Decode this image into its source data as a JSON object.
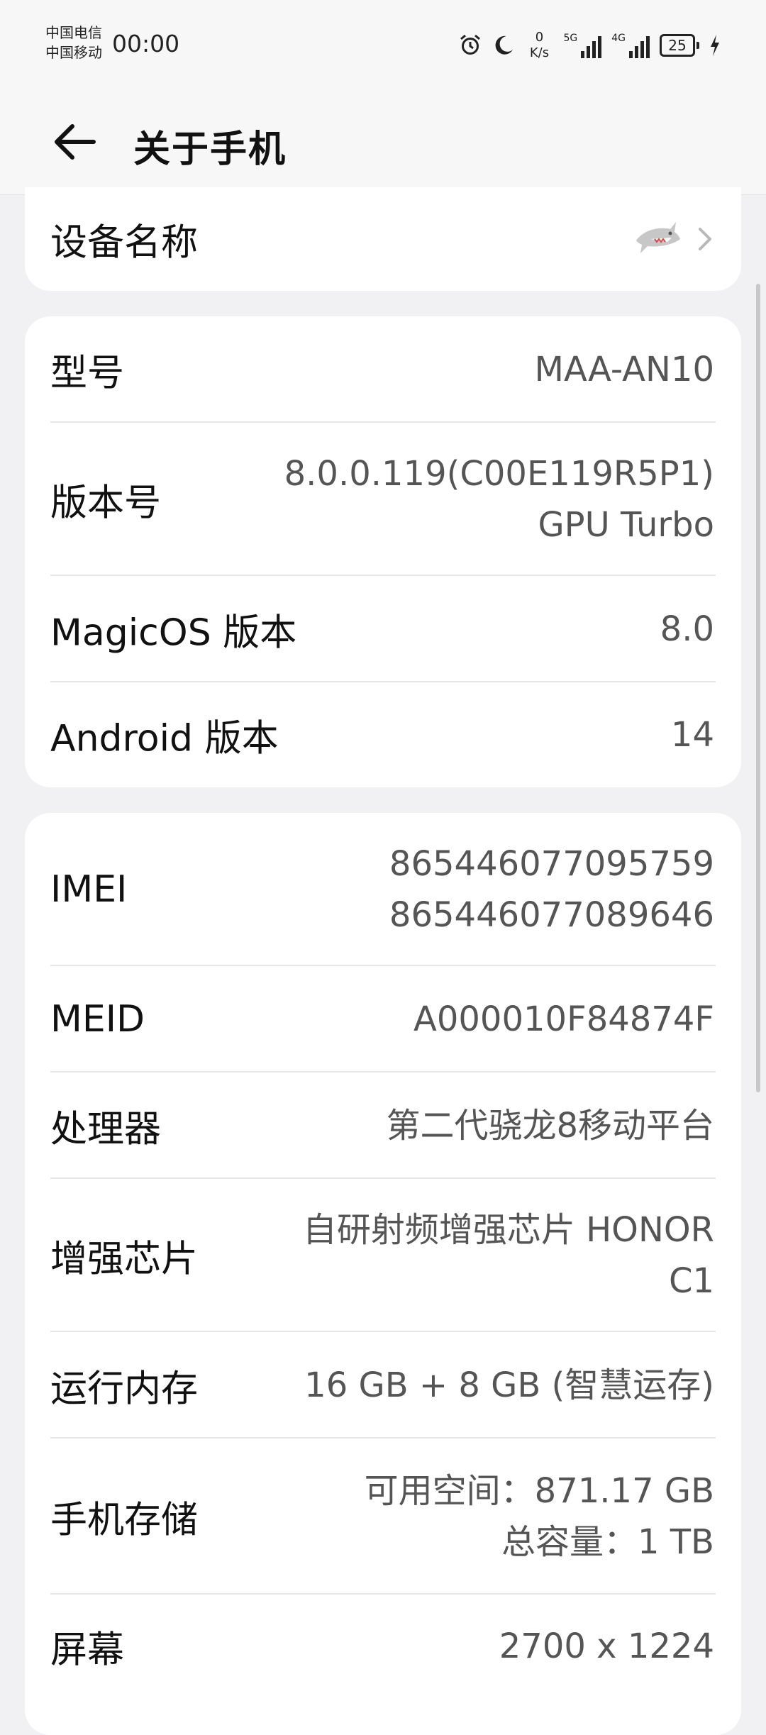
{
  "status_bar": {
    "carrier1": "中国电信",
    "carrier2": "中国移动",
    "time": "00:00",
    "net_speed_value": "0",
    "net_speed_unit": "K/s",
    "sim1_tag": "5G",
    "sim2_tag": "4G",
    "battery": "25",
    "icons": [
      "alarm-icon",
      "moon-icon",
      "signal-icon",
      "battery-icon",
      "charging-icon"
    ]
  },
  "header": {
    "title": "关于手机"
  },
  "device_name": {
    "label": "设备名称"
  },
  "info": {
    "model_label": "型号",
    "model_value": "MAA-AN10",
    "build_label": "版本号",
    "build_value_line1": "8.0.0.119(C00E119R5P1)",
    "build_value_line2": "GPU Turbo",
    "magicos_label": "MagicOS 版本",
    "magicos_value": "8.0",
    "android_label": "Android 版本",
    "android_value": "14"
  },
  "hardware": {
    "imei_label": "IMEI",
    "imei_value_line1": "865446077095759",
    "imei_value_line2": "865446077089646",
    "meid_label": "MEID",
    "meid_value": "A000010F84874F",
    "cpu_label": "处理器",
    "cpu_value": "第二代骁龙8移动平台",
    "chip_label": "增强芯片",
    "chip_value_line1": "自研射频增强芯片 HONOR",
    "chip_value_line2": "C1",
    "ram_label": "运行内存",
    "ram_value": "16 GB + 8 GB (智慧运存)",
    "storage_label": "手机存储",
    "storage_value_line1": "可用空间：871.17  GB",
    "storage_value_line2": "总容量：1 TB",
    "screen_label": "屏幕",
    "screen_value": "2700 x 1224"
  }
}
